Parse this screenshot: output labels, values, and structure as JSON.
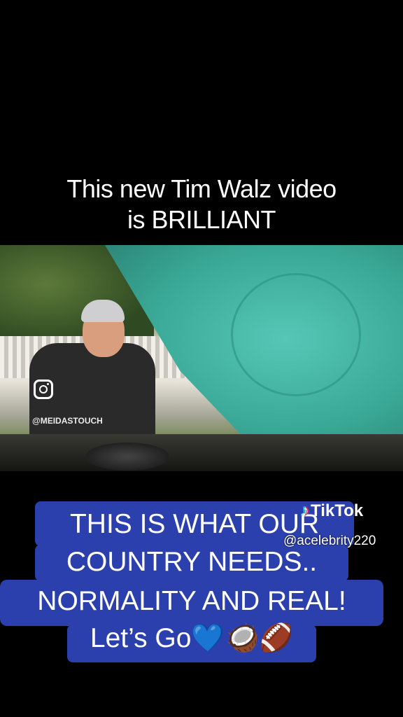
{
  "title": {
    "line1": "This new Tim Walz video",
    "line2": "is BRILLIANT"
  },
  "video": {
    "watermark_icon": "instagram-icon",
    "watermark_handle": "@MEIDASTOUCH"
  },
  "caption": {
    "line1": "THIS IS WHAT OUR",
    "line2": "COUNTRY NEEDS..",
    "line3": "NORMALITY AND REAL!",
    "line4": "Let’s Go💙🥥🏈"
  },
  "tiktok": {
    "logo_icon": "tiktok-logo-icon",
    "label": "TikTok",
    "username": "@acelebrity220"
  },
  "colors": {
    "caption_bg": "#2b40ad",
    "hood": "#3fb8a8"
  }
}
